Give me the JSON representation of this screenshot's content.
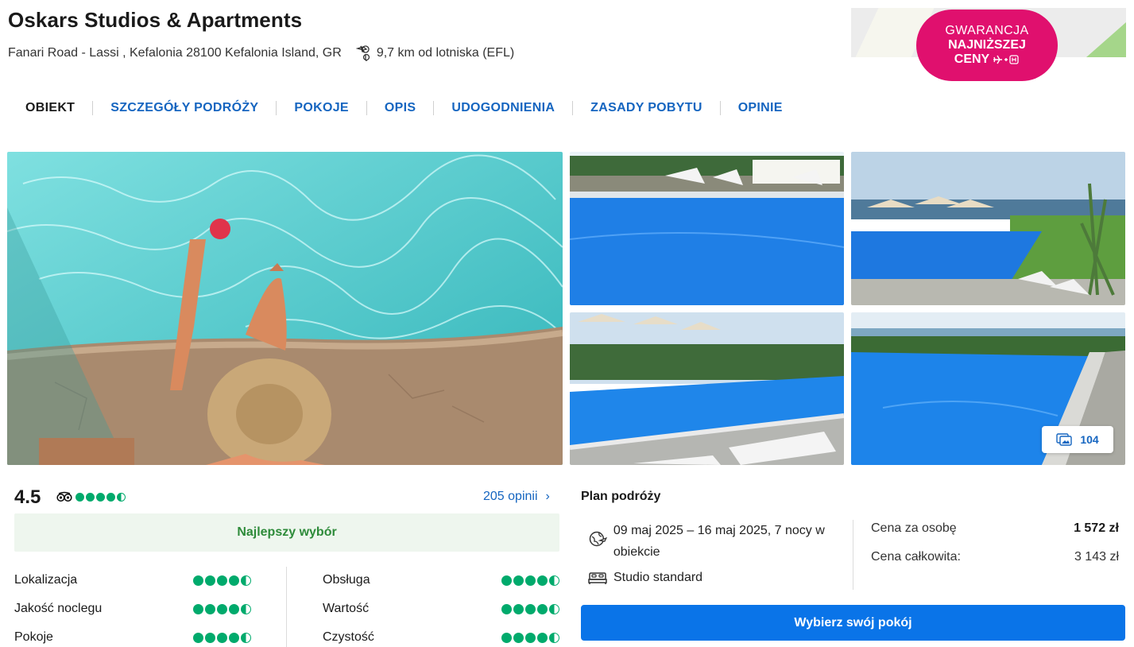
{
  "hotel": {
    "name": "Oskars Studios & Apartments",
    "address": "Fanari Road - Lassi , Kefalonia 28100 Kefalonia Island, GR",
    "airport_distance": "9,7 km od lotniska (EFL)"
  },
  "badge": {
    "line1": "GWARANCJA",
    "line2": "NAJNIŻSZEJ",
    "line3": "CENY",
    "icon": "plane-plus-hotel-icon",
    "color": "#e0106e"
  },
  "tabs": [
    {
      "label": "OBIEKT",
      "active": true
    },
    {
      "label": "SZCZEGÓŁY PODRÓŻY",
      "active": false
    },
    {
      "label": "POKOJE",
      "active": false
    },
    {
      "label": "OPIS",
      "active": false
    },
    {
      "label": "UDOGODNIENIA",
      "active": false
    },
    {
      "label": "ZASADY POBYTU",
      "active": false
    },
    {
      "label": "OPINIE",
      "active": false
    }
  ],
  "gallery": {
    "photo_count": "104",
    "count_icon": "gallery-icon"
  },
  "rating": {
    "score": "4.5",
    "provider_icon": "tripadvisor-icon",
    "bubbles": 4.5,
    "reviews_link": "205 opinii",
    "highlight": "Najlepszy wybór",
    "categories": [
      {
        "label": "Lokalizacja",
        "bubbles": 4.5
      },
      {
        "label": "Obsługa",
        "bubbles": 4.5
      },
      {
        "label": "Jakość noclegu",
        "bubbles": 4.5
      },
      {
        "label": "Wartość",
        "bubbles": 4.5
      },
      {
        "label": "Pokoje",
        "bubbles": 4.5
      },
      {
        "label": "Czystość",
        "bubbles": 4.5
      }
    ]
  },
  "plan": {
    "title": "Plan podróży",
    "dates": "09 maj 2025 – 16 maj 2025, 7 nocy w obiekcie",
    "dates_icon": "globe-plane-icon",
    "room": "Studio standard",
    "room_icon": "bed-icon",
    "price_per_person_label": "Cena za osobę",
    "price_per_person": "1 572 zł",
    "total_label": "Cena całkowita:",
    "total": "3 143 zł",
    "cta": "Wybierz swój pokój"
  },
  "colors": {
    "link": "#1565c0",
    "cta": "#0a74e8",
    "tripadvisor_green": "#00aa6c",
    "highlight_text": "#2e8b3a"
  }
}
